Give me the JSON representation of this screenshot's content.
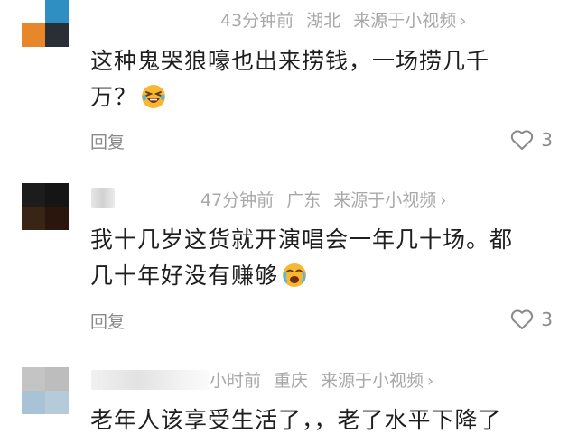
{
  "comments": [
    {
      "meta": {
        "time": "43分钟前",
        "location": "湖北",
        "source": "来源于小视频"
      },
      "text_lines": [
        "这种鬼哭狼嚎也出来捞钱，一场捞几千",
        "万？"
      ],
      "emoji": "laughing-crying-emoji",
      "reply_label": "回复",
      "likes": "3",
      "colors": {
        "avatar": [
          "#ffffff",
          "#2f8fc3",
          "#e8862a",
          "#2a2f36"
        ]
      }
    },
    {
      "meta": {
        "time": "47分钟前",
        "location": "广东",
        "source": "来源于小视频"
      },
      "text_lines": [
        "我十几岁这货就开演唱会一年几十场。都",
        "几十年好没有赚够"
      ],
      "emoji": "crying-laughing-emoji",
      "reply_label": "回复",
      "likes": "3",
      "colors": {
        "avatar": [
          "#1c1c1c",
          "#151515",
          "#3a2416",
          "#2b160d"
        ]
      }
    },
    {
      "meta": {
        "time": "小时前",
        "location": "重庆",
        "source": "来源于小视频"
      },
      "text_lines": [
        "老年人该享受生活了，，老了水平下降了"
      ],
      "colors": {
        "avatar": [
          "#c4c4c4",
          "#bdbdbd",
          "#a9c3d6",
          "#b6cbd9"
        ]
      }
    }
  ],
  "chevron_glyph": "›"
}
